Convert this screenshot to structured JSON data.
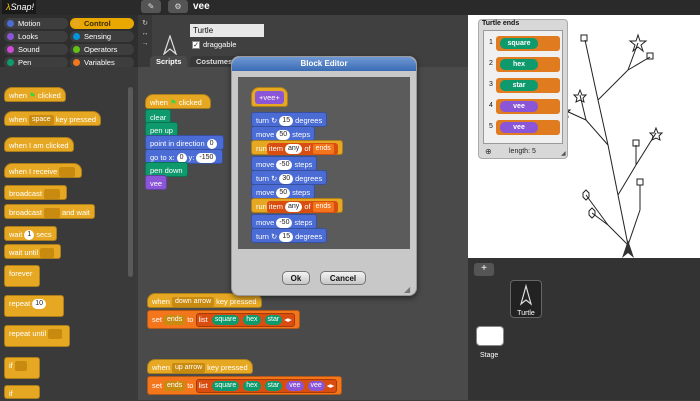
{
  "app": {
    "logo": "Snap!",
    "project_name": "vee"
  },
  "categories": [
    {
      "label": "Motion",
      "color": "#4a6cd4"
    },
    {
      "label": "Control",
      "color": "#e6a822",
      "selected": true
    },
    {
      "label": "Looks",
      "color": "#8a55d7"
    },
    {
      "label": "Sensing",
      "color": "#0494dc"
    },
    {
      "label": "Sound",
      "color": "#cf4ad9"
    },
    {
      "label": "Operators",
      "color": "#62c213"
    },
    {
      "label": "Pen",
      "color": "#0e9a6c"
    },
    {
      "label": "Variables",
      "color": "#f3761d"
    }
  ],
  "palette": {
    "when_flag": "when",
    "when_flag_suffix": "clicked",
    "when_key": "when",
    "when_key_value": "space",
    "when_key_suffix": "key pressed",
    "when_clicked": "when I am clicked",
    "when_receive": "when I receive",
    "broadcast": "broadcast",
    "broadcast_wait": "broadcast",
    "broadcast_wait_suffix": "and wait",
    "wait": "wait",
    "wait_value": "1",
    "wait_suffix": "secs",
    "wait_until": "wait until",
    "forever": "forever",
    "repeat": "repeat",
    "repeat_value": "10",
    "repeat_until": "repeat until",
    "if": "if"
  },
  "sprite": {
    "name": "Turtle",
    "draggable_label": "draggable",
    "tabs": [
      "Scripts",
      "Costumes"
    ]
  },
  "script1": {
    "hat": "when",
    "hat_suffix": "clicked",
    "clear": "clear",
    "pen_up": "pen up",
    "point": "point in direction",
    "point_value": "0",
    "goto": "go to x:",
    "goto_x": "0",
    "goto_y_label": "y:",
    "goto_y": "-150",
    "pen_down": "pen down",
    "call": "vee"
  },
  "script2": {
    "hat": "when",
    "key": "down arrow",
    "hat_suffix": "key pressed",
    "set": "set",
    "var": "ends",
    "to_list": "to",
    "list_word": "list",
    "items": [
      "square",
      "hex",
      "star"
    ]
  },
  "script3": {
    "hat": "when",
    "key": "up arrow",
    "hat_suffix": "key pressed",
    "set": "set",
    "var": "ends",
    "to_list": "to",
    "list_word": "list",
    "items": [
      "square",
      "hex",
      "star",
      "vee",
      "vee"
    ]
  },
  "dialog": {
    "title": "Block Editor",
    "hat_name": "vee",
    "lines": [
      {
        "kind": "turn",
        "pre": "turn",
        "val": "15",
        "post": "degrees"
      },
      {
        "kind": "move",
        "pre": "move",
        "val": "50",
        "post": "steps"
      },
      {
        "kind": "run",
        "pre": "run",
        "item": "item",
        "idx": "any",
        "of": "of",
        "list": "ends"
      },
      {
        "kind": "move",
        "pre": "move",
        "val": "-50",
        "post": "steps"
      },
      {
        "kind": "turn",
        "pre": "turn",
        "val": "30",
        "post": "degrees"
      },
      {
        "kind": "move",
        "pre": "move",
        "val": "50",
        "post": "steps"
      },
      {
        "kind": "run",
        "pre": "run",
        "item": "item",
        "idx": "any",
        "of": "of",
        "list": "ends"
      },
      {
        "kind": "move",
        "pre": "move",
        "val": "-50",
        "post": "steps"
      },
      {
        "kind": "turn",
        "pre": "turn",
        "val": "15",
        "post": "degrees"
      }
    ],
    "ok": "Ok",
    "cancel": "Cancel"
  },
  "watcher": {
    "title": "Turtle ends",
    "items": [
      {
        "index": "1",
        "label": "square",
        "color": "#0e9a6c"
      },
      {
        "index": "2",
        "label": "hex",
        "color": "#0e9a6c"
      },
      {
        "index": "3",
        "label": "star",
        "color": "#0e9a6c"
      },
      {
        "index": "4",
        "label": "vee",
        "color": "#8a55d7"
      },
      {
        "index": "5",
        "label": "vee",
        "color": "#8a55d7"
      }
    ],
    "length_label": "length: 5"
  },
  "corral": {
    "add_label": "+",
    "sprite_label": "Turtle",
    "stage_label": "Stage"
  }
}
